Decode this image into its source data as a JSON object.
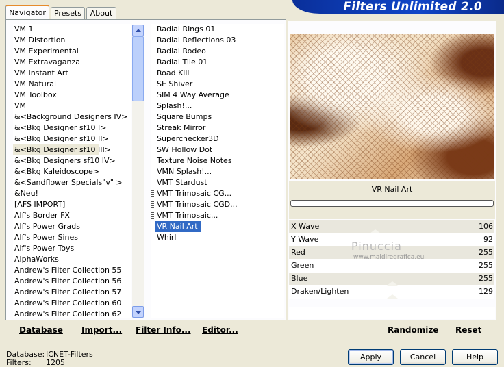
{
  "banner_title": "Filters Unlimited 2.0",
  "tabs": [
    "Navigator",
    "Presets",
    "About"
  ],
  "categories": [
    "VM 1",
    "VM Distortion",
    "VM Experimental",
    "VM Extravaganza",
    "VM Instant Art",
    "VM Natural",
    "VM Toolbox",
    "VM",
    "&<Background Designers IV>",
    "&<Bkg Designer sf10 I>",
    "&<Bkg Designer sf10 II>",
    "&<Bkg Designer sf10 III>",
    "&<Bkg Designers sf10 IV>",
    "&<Bkg Kaleidoscope>",
    "&<Sandflower Specials\"v\" >",
    "&Neu!",
    "[AFS IMPORT]",
    "Alf's Border FX",
    "Alf's Power Grads",
    "Alf's Power Sines",
    "Alf's Power Toys",
    "AlphaWorks",
    "Andrew's Filter Collection 55",
    "Andrew's Filter Collection 56",
    "Andrew's Filter Collection 57",
    "Andrew's Filter Collection 60",
    "Andrew's Filter Collection 62"
  ],
  "selected_category": "&<Bkg Designer sf10 III>",
  "filters": [
    "Radial  Rings 01",
    "Radial Reflections 03",
    "Radial Rodeo",
    "Radial Tile 01",
    "Road Kill",
    "SE Shiver",
    "SIM 4 Way Average",
    "Splash!...",
    "Square Bumps",
    "Streak Mirror",
    "Superchecker3D",
    "SW Hollow Dot",
    "Texture Noise Notes",
    "VMN Splash!...",
    "VMT Stardust",
    "VMT Trimosaic CG...",
    "VMT Trimosaic CGD...",
    "VMT Trimosaic...",
    "VR Nail Art",
    "Whirl"
  ],
  "selected_filter": "VR Nail Art",
  "filter_name": "VR Nail Art",
  "params": [
    {
      "label": "X Wave",
      "value": "106"
    },
    {
      "label": "Y Wave",
      "value": "92"
    },
    {
      "label": "Red",
      "value": "255"
    },
    {
      "label": "Green",
      "value": "255"
    },
    {
      "label": "Blue",
      "value": "255"
    },
    {
      "label": "Draken/Lighten",
      "value": "129"
    }
  ],
  "bottom_buttons": {
    "database": "Database",
    "import": "Import...",
    "filter_info": "Filter Info...",
    "editor": "Editor...",
    "randomize": "Randomize",
    "reset": "Reset"
  },
  "watermark": {
    "name": "Pinuccia",
    "url": "www.maidiregrafica.eu"
  },
  "status": {
    "database_label": "Database:",
    "database_value": "ICNET-Filters",
    "filters_label": "Filters:",
    "filters_value": "1205"
  },
  "dialog_buttons": {
    "apply": "Apply",
    "cancel": "Cancel",
    "help": "Help"
  }
}
